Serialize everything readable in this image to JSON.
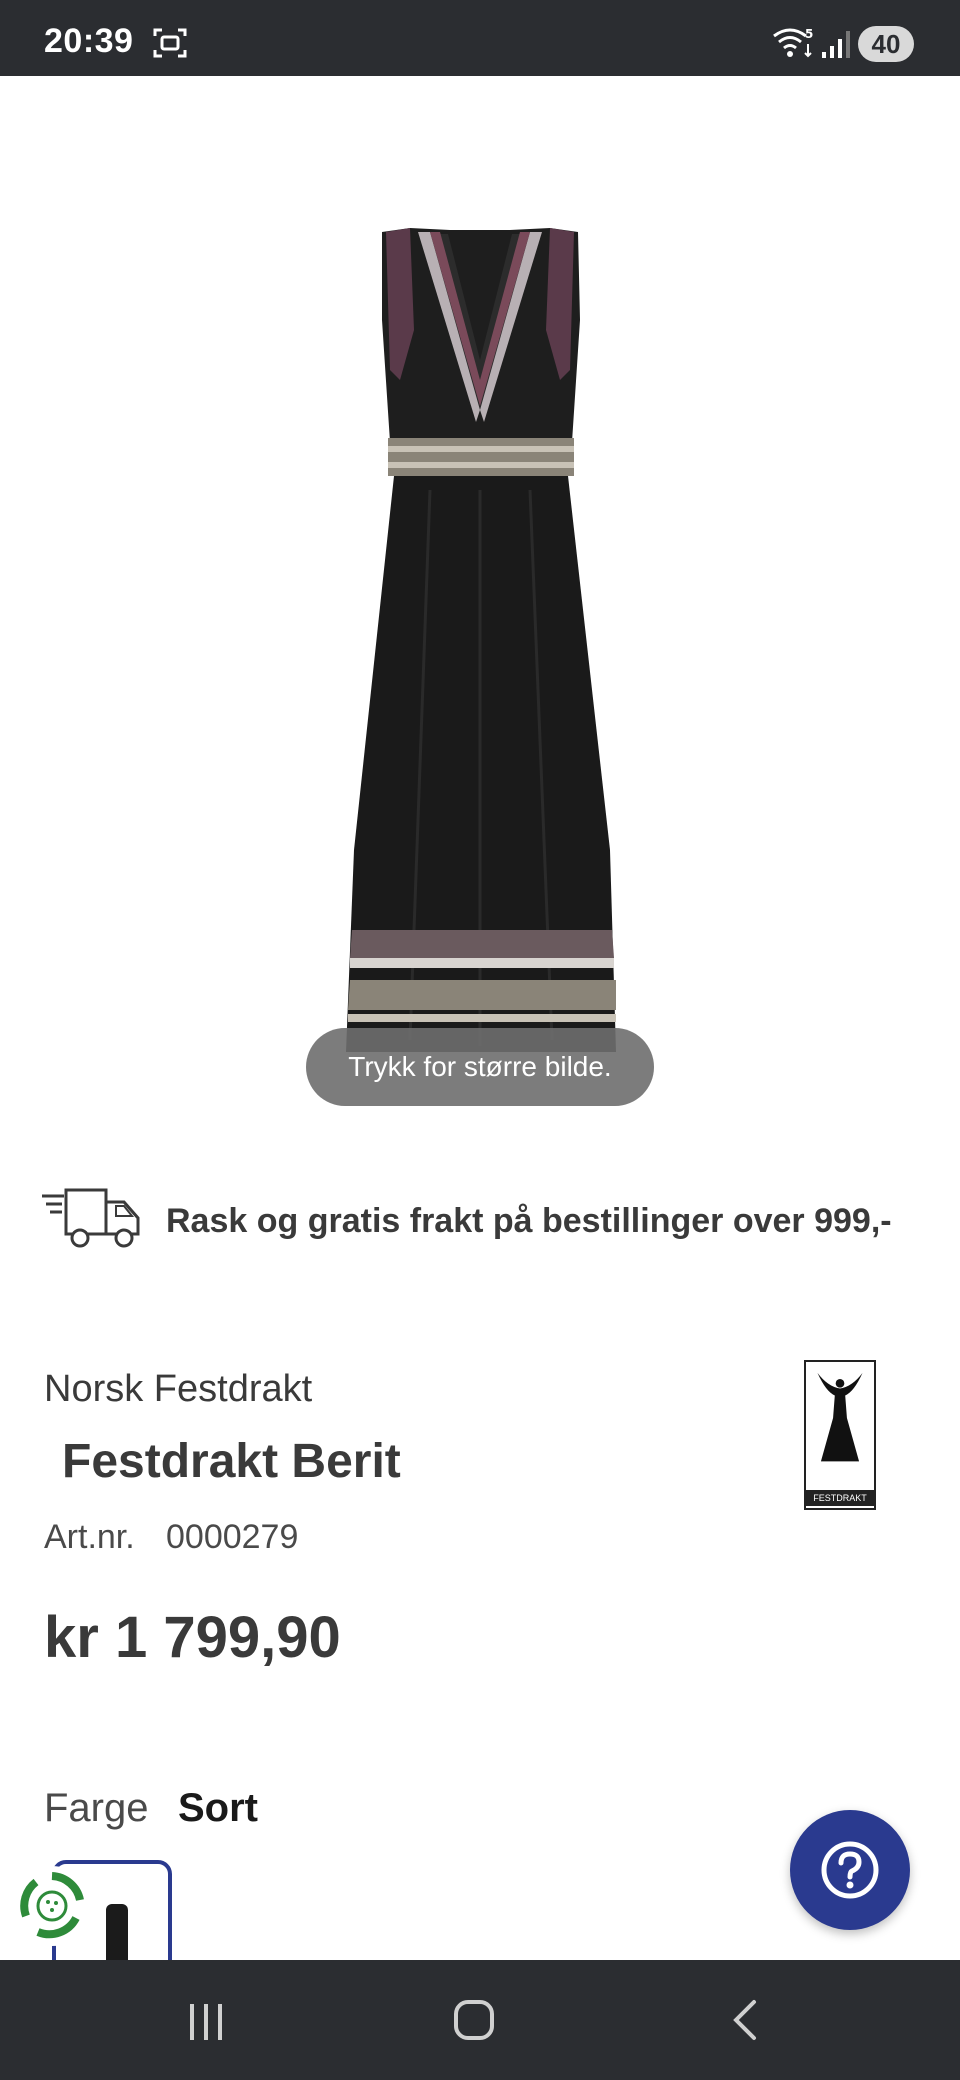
{
  "status_bar": {
    "time": "20:39",
    "battery": "40",
    "icons": [
      "screen-record-icon",
      "wifi-icon",
      "signal-icon",
      "battery-icon"
    ]
  },
  "product_image": {
    "enlarge_hint": "Trykk for større bilde."
  },
  "shipping": {
    "icon": "truck-icon",
    "text": "Rask og gratis frakt på bestillinger over 999,-"
  },
  "product": {
    "brand": "Norsk Festdrakt",
    "logo_text": "FESTDRAKT",
    "title": "Festdrakt Berit",
    "art_label": "Art.nr.",
    "art_number": "0000279",
    "price": "kr 1 799,90"
  },
  "color": {
    "label": "Farge",
    "value": "Sort"
  },
  "help": {
    "icon": "question-icon"
  },
  "colors": {
    "accent": "#2a3a8f",
    "system_bar": "#2b2d31",
    "text": "#3a3a3a"
  }
}
